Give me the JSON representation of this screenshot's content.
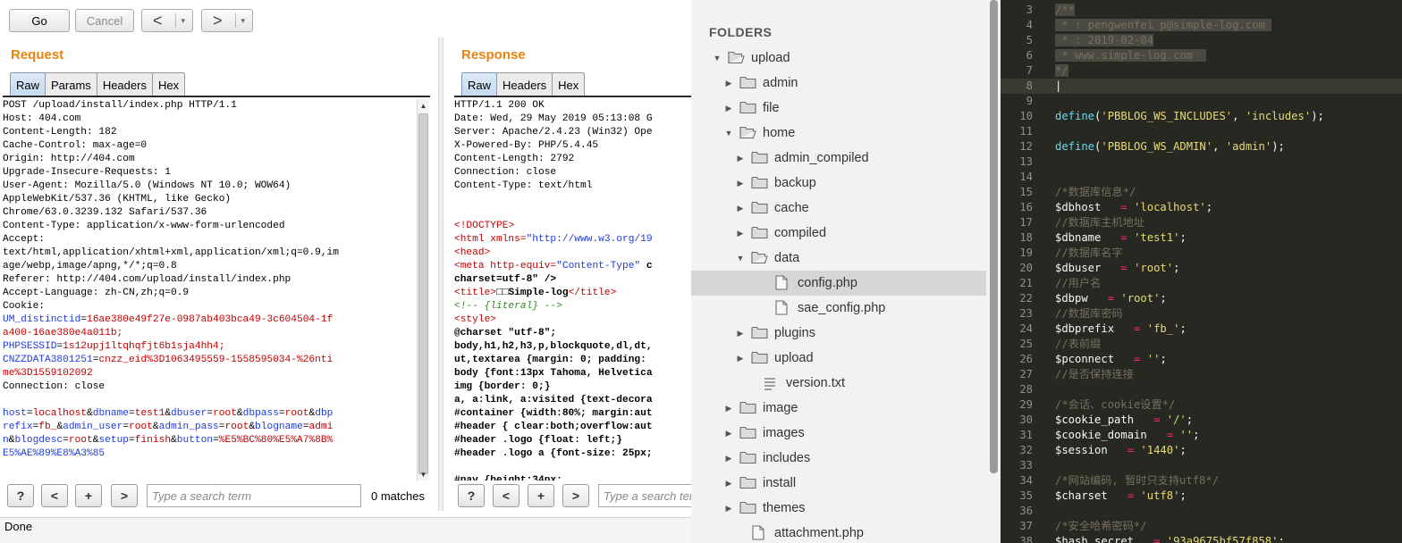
{
  "burp": {
    "toolbar": {
      "go": "Go",
      "cancel": "Cancel",
      "back": "<",
      "forward": ">",
      "dropdown": "▾"
    },
    "request": {
      "title": "Request",
      "tabs": [
        "Raw",
        "Params",
        "Headers",
        "Hex"
      ],
      "active_tab": "Raw",
      "lines": [
        "POST /upload/install/index.php HTTP/1.1",
        "Host: 404.com",
        "Content-Length: 182",
        "Cache-Control: max-age=0",
        "Origin: http://404.com",
        "Upgrade-Insecure-Requests: 1",
        "User-Agent: Mozilla/5.0 (Windows NT 10.0; WOW64)",
        "AppleWebKit/537.36 (KHTML, like Gecko)",
        "Chrome/63.0.3239.132 Safari/537.36",
        "Content-Type: application/x-www-form-urlencoded",
        "Accept:",
        "text/html,application/xhtml+xml,application/xml;q=0.9,im",
        "age/webp,image/apng,*/*;q=0.8",
        "Referer: http://404.com/upload/install/index.php",
        "Accept-Language: zh-CN,zh;q=0.9",
        "Cookie:"
      ],
      "cookie_lines": [
        "UM_distinctid=16ae380e49f27e-0987ab403bca49-3c604504-1f",
        "a400-16ae380e4a011b;",
        "PHPSESSID=1s12upj1ltqhqfjt6b1sja4hh4;",
        "CNZZDATA3801251=cnzz_eid%3D1063495559-1558595034-%26nti",
        "me%3D1559102092"
      ],
      "connection": "Connection: close",
      "body_lines": [
        "host=localhost&dbname=test1&dbuser=root&dbpass=root&dbp",
        "refix=fb_&admin_user=root&admin_pass=root&blogname=admi",
        "n&blogdesc=root&setup=finish&button=%E5%BC%80%E5%A7%8B%",
        "E5%AE%89%E8%A3%85"
      ],
      "search_placeholder": "Type a search term",
      "matches": "0 matches"
    },
    "response": {
      "title": "Response",
      "tabs": [
        "Raw",
        "Headers",
        "Hex"
      ],
      "active_tab": "Raw",
      "lines": [
        "HTTP/1.1 200 OK",
        "Date: Wed, 29 May 2019 05:13:08 G",
        "Server: Apache/2.4.23 (Win32) Ope",
        "X-Powered-By: PHP/5.4.45",
        "Content-Length: 2792",
        "Connection: close",
        "Content-Type: text/html"
      ],
      "html_lines": [
        "<!DOCTYPE>",
        "<html xmlns=\"http://www.w3.org/19",
        "<head>",
        "<meta http-equiv=\"Content-Type\" c",
        "charset=utf-8\" />",
        "<title>□□Simple-log</title>",
        "<!-- {literal} -->",
        "<style>",
        "@charset \"utf-8\";",
        "body,h1,h2,h3,p,blockquote,dl,dt,",
        "ut,textarea {margin: 0; padding:",
        "body {font:13px Tahoma, Helvetica",
        "img {border: 0;}",
        "a, a:link, a:visited {text-decora",
        "#container {width:80%; margin:aut",
        "#header { clear:both;overflow:aut",
        "#header .logo {float: left;}",
        "#header .logo a {font-size: 25px;",
        "",
        "#nav {height:34px;"
      ],
      "search_placeholder": "Type a search term"
    },
    "search_buttons": [
      "?",
      "<",
      "+",
      ">"
    ],
    "status": "Done"
  },
  "folders": {
    "header": "FOLDERS",
    "items": [
      {
        "label": "upload",
        "type": "folder",
        "open": true,
        "depth": 0
      },
      {
        "label": "admin",
        "type": "folder",
        "open": false,
        "depth": 1
      },
      {
        "label": "file",
        "type": "folder",
        "open": false,
        "depth": 1
      },
      {
        "label": "home",
        "type": "folder",
        "open": true,
        "depth": 1
      },
      {
        "label": "admin_compiled",
        "type": "folder",
        "open": false,
        "depth": 2
      },
      {
        "label": "backup",
        "type": "folder",
        "open": false,
        "depth": 2
      },
      {
        "label": "cache",
        "type": "folder",
        "open": false,
        "depth": 2
      },
      {
        "label": "compiled",
        "type": "folder",
        "open": false,
        "depth": 2
      },
      {
        "label": "data",
        "type": "folder",
        "open": true,
        "depth": 2
      },
      {
        "label": "config.php",
        "type": "file",
        "depth": 3,
        "selected": true
      },
      {
        "label": "sae_config.php",
        "type": "file",
        "depth": 3
      },
      {
        "label": "plugins",
        "type": "folder",
        "open": false,
        "depth": 2
      },
      {
        "label": "upload",
        "type": "folder",
        "open": false,
        "depth": 2
      },
      {
        "label": "version.txt",
        "type": "text",
        "depth": 2
      },
      {
        "label": "image",
        "type": "folder",
        "open": false,
        "depth": 1
      },
      {
        "label": "images",
        "type": "folder",
        "open": false,
        "depth": 1
      },
      {
        "label": "includes",
        "type": "folder",
        "open": false,
        "depth": 1
      },
      {
        "label": "install",
        "type": "folder",
        "open": false,
        "depth": 1
      },
      {
        "label": "themes",
        "type": "folder",
        "open": false,
        "depth": 1
      },
      {
        "label": "attachment.php",
        "type": "file",
        "depth": 1
      }
    ]
  },
  "code": {
    "lines": [
      {
        "n": "3",
        "tokens": [
          [
            "cmt hl",
            "/**"
          ]
        ]
      },
      {
        "n": "4",
        "tokens": [
          [
            "cmt hl",
            " * : pengwenfei p@simple-log.com "
          ]
        ]
      },
      {
        "n": "5",
        "tokens": [
          [
            "cmt hl",
            " * : 2019-02-04"
          ]
        ]
      },
      {
        "n": "6",
        "tokens": [
          [
            "cmt hl",
            " * www.simple-log.com  "
          ]
        ]
      },
      {
        "n": "7",
        "tokens": [
          [
            "cmt hl",
            "*/"
          ]
        ]
      },
      {
        "n": "8",
        "tokens": [],
        "current": true
      },
      {
        "n": "9",
        "tokens": []
      },
      {
        "n": "10",
        "tokens": [
          [
            "fn",
            "define"
          ],
          [
            "",
            "("
          ],
          [
            "str",
            "'PBBLOG_WS_INCLUDES'"
          ],
          [
            "",
            ", "
          ],
          [
            "str",
            "'includes'"
          ],
          [
            "",
            ");"
          ]
        ]
      },
      {
        "n": "11",
        "tokens": []
      },
      {
        "n": "12",
        "tokens": [
          [
            "fn",
            "define"
          ],
          [
            "",
            "("
          ],
          [
            "str",
            "'PBBLOG_WS_ADMIN'"
          ],
          [
            "",
            ", "
          ],
          [
            "str",
            "'admin'"
          ],
          [
            "",
            ");"
          ]
        ]
      },
      {
        "n": "13",
        "tokens": []
      },
      {
        "n": "14",
        "tokens": []
      },
      {
        "n": "15",
        "tokens": [
          [
            "cmt",
            "/*数据库信息*/"
          ]
        ]
      },
      {
        "n": "16",
        "tokens": [
          [
            "",
            "$dbhost   "
          ],
          [
            "op",
            "="
          ],
          [
            "",
            " "
          ],
          [
            "str",
            "'localhost'"
          ],
          [
            "",
            ";"
          ]
        ]
      },
      {
        "n": "17",
        "tokens": [
          [
            "cmt",
            "//数据库主机地址"
          ]
        ]
      },
      {
        "n": "18",
        "tokens": [
          [
            "",
            "$dbname   "
          ],
          [
            "op",
            "="
          ],
          [
            "",
            " "
          ],
          [
            "str",
            "'test1'"
          ],
          [
            "",
            ";"
          ]
        ]
      },
      {
        "n": "19",
        "tokens": [
          [
            "cmt",
            "//数据库名字"
          ]
        ]
      },
      {
        "n": "20",
        "tokens": [
          [
            "",
            "$dbuser   "
          ],
          [
            "op",
            "="
          ],
          [
            "",
            " "
          ],
          [
            "str",
            "'root'"
          ],
          [
            "",
            ";"
          ]
        ]
      },
      {
        "n": "21",
        "tokens": [
          [
            "cmt",
            "//用户名"
          ]
        ]
      },
      {
        "n": "22",
        "tokens": [
          [
            "",
            "$dbpw   "
          ],
          [
            "op",
            "="
          ],
          [
            "",
            " "
          ],
          [
            "str",
            "'root'"
          ],
          [
            "",
            ";"
          ]
        ]
      },
      {
        "n": "23",
        "tokens": [
          [
            "cmt",
            "//数据库密码"
          ]
        ]
      },
      {
        "n": "24",
        "tokens": [
          [
            "",
            "$dbprefix   "
          ],
          [
            "op",
            "="
          ],
          [
            "",
            " "
          ],
          [
            "str",
            "'fb_'"
          ],
          [
            "",
            ";"
          ]
        ]
      },
      {
        "n": "25",
        "tokens": [
          [
            "cmt",
            "//表前缀"
          ]
        ]
      },
      {
        "n": "26",
        "tokens": [
          [
            "",
            "$pconnect   "
          ],
          [
            "op",
            "="
          ],
          [
            "",
            " "
          ],
          [
            "str",
            "''"
          ],
          [
            "",
            ";"
          ]
        ]
      },
      {
        "n": "27",
        "tokens": [
          [
            "cmt",
            "//是否保持连接"
          ]
        ]
      },
      {
        "n": "28",
        "tokens": []
      },
      {
        "n": "29",
        "tokens": [
          [
            "cmt",
            "/*会话、cookie设置*/"
          ]
        ]
      },
      {
        "n": "30",
        "tokens": [
          [
            "",
            "$cookie_path   "
          ],
          [
            "op",
            "="
          ],
          [
            "",
            " "
          ],
          [
            "str",
            "'/'"
          ],
          [
            "",
            ";"
          ]
        ]
      },
      {
        "n": "31",
        "tokens": [
          [
            "",
            "$cookie_domain   "
          ],
          [
            "op",
            "="
          ],
          [
            "",
            " "
          ],
          [
            "str",
            "''"
          ],
          [
            "",
            ";"
          ]
        ]
      },
      {
        "n": "32",
        "tokens": [
          [
            "",
            "$session   "
          ],
          [
            "op",
            "="
          ],
          [
            "",
            " "
          ],
          [
            "str",
            "'1440'"
          ],
          [
            "",
            ";"
          ]
        ]
      },
      {
        "n": "33",
        "tokens": []
      },
      {
        "n": "34",
        "tokens": [
          [
            "cmt",
            "/*网站编码, 暂时只支持utf8*/"
          ]
        ]
      },
      {
        "n": "35",
        "tokens": [
          [
            "",
            "$charset   "
          ],
          [
            "op",
            "="
          ],
          [
            "",
            " "
          ],
          [
            "str",
            "'utf8'"
          ],
          [
            "",
            ";"
          ]
        ]
      },
      {
        "n": "36",
        "tokens": []
      },
      {
        "n": "37",
        "tokens": [
          [
            "cmt",
            "/*安全哈希密码*/"
          ]
        ]
      },
      {
        "n": "38",
        "tokens": [
          [
            "",
            "$hash_secret   "
          ],
          [
            "op",
            "="
          ],
          [
            "",
            " "
          ],
          [
            "str",
            "'93a9675bf57f858'"
          ],
          [
            "",
            ";"
          ]
        ]
      }
    ]
  }
}
